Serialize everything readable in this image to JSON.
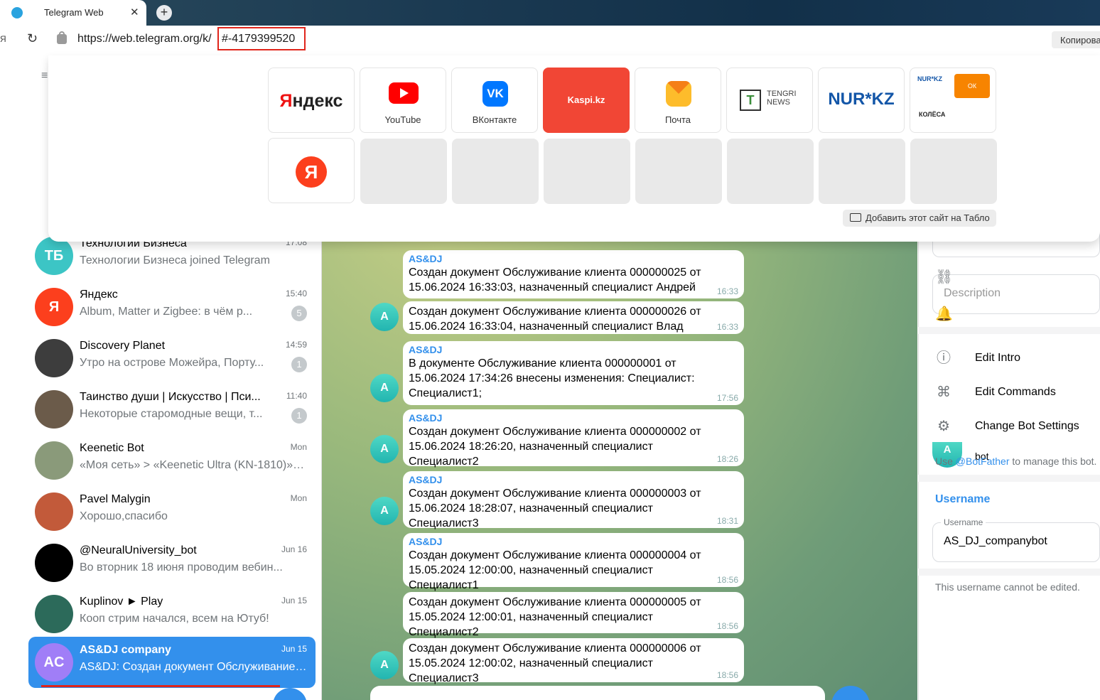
{
  "browser": {
    "tab_title": "Telegram Web",
    "tab_close": "✕",
    "new_tab": "+",
    "url_base": "https://web.telegram.org/k/",
    "url_hash": "#-4179399520",
    "copy_label": "Копирова"
  },
  "tablo": {
    "tiles": [
      {
        "label": "Яндекс"
      },
      {
        "label": "YouTube"
      },
      {
        "label": "ВКонтакте"
      },
      {
        "label": "Kaspi.kz"
      },
      {
        "label": "Почта"
      },
      {
        "label": "TENGRI NEWS"
      },
      {
        "label": "NUR KZ"
      },
      {
        "label": "NUR KZ / OK / Колёса"
      }
    ],
    "tengri_line1": "TENGRI",
    "tengri_line2": "NEWS",
    "nur_logo": "NUR*KZ",
    "mini_nur": "NUR*KZ",
    "mini_ok": "ОК",
    "mini_kolesa": "КОЛЁСА",
    "yandex_round": "Я",
    "add_label": "Добавить этот сайт на Табло"
  },
  "sidebar": {
    "menu_icon": "≡",
    "chats": [
      {
        "initials": "ТБ",
        "name": "Технологии Бизнеса",
        "message": "Технологии Бизнеса joined Telegram",
        "time": "17:08",
        "color": "#3cc5c5"
      },
      {
        "initials": "Я",
        "name": "Яндекс",
        "message": "Album, Matter и Zigbee: в чём р...",
        "time": "15:40",
        "badge": "5",
        "color": "#fc3f1d"
      },
      {
        "initials": "",
        "name": "Discovery Planet",
        "message": "Утро на острове Можейра, Порту...",
        "time": "14:59",
        "badge": "1",
        "color": "#3d3d3d"
      },
      {
        "initials": "",
        "name": "Таинство души | Искусство | Пси...",
        "message": "Некоторые старомодные вещи, т...",
        "time": "11:40",
        "badge": "1",
        "color": "#6b5b4a"
      },
      {
        "initials": "",
        "name": "Keenetic Bot",
        "message": "«Моя сеть» > «Keenetic Ultra (KN-1810)» Н...",
        "time": "Mon",
        "color": "#8a9a7a"
      },
      {
        "initials": "",
        "name": "Pavel Malygin",
        "message": "Хорошо,спасибо",
        "time": "Mon",
        "color": "#c25a3a"
      },
      {
        "initials": "",
        "name": "@NeuralUniversity_bot",
        "message": "Во вторник 18 июня проводим вебин...",
        "time": "Jun 16",
        "color": "#000000"
      },
      {
        "initials": "",
        "name": "Kuplinov ► Play",
        "message": "Кооп стрим начался, всем на Ютуб!",
        "time": "Jun 15",
        "color": "#2c6a5a"
      },
      {
        "initials": "AC",
        "name": "AS&DJ company",
        "message": "AS&DJ: Создан документ Обслуживание ...",
        "time": "Jun 15",
        "color": "#a07ef7",
        "active": true
      }
    ]
  },
  "messages": [
    {
      "sender": "AS&DJ",
      "text": "Создан документ Обслуживание клиента 000000025 от 15.06.2024 16:33:03, назначенный специалист Андрей",
      "time": "16:33"
    },
    {
      "sender": "",
      "text": "Создан документ Обслуживание клиента 000000026 от 15.06.2024 16:33:04, назначенный специалист Влад",
      "time": "16:33",
      "avatar": "A"
    },
    {
      "sender": "AS&DJ",
      "text": "В документе Обслуживание клиента 000000001 от 15.06.2024 17:34:26 внесены изменения: Специалист: Специалист1;",
      "time": "17:56",
      "avatar": "A"
    },
    {
      "sender": "AS&DJ",
      "text": "Создан документ Обслуживание клиента 000000002 от 15.06.2024 18:26:20, назначенный специалист Специалист2",
      "time": "18:26",
      "avatar": "A"
    },
    {
      "sender": "AS&DJ",
      "text": "Создан документ Обслуживание клиента 000000003 от 15.06.2024 18:28:07, назначенный специалист Специалист3",
      "time": "18:31",
      "avatar": "A"
    },
    {
      "sender": "AS&DJ",
      "text": "Создан документ Обслуживание клиента 000000004 от 15.05.2024 12:00:00, назначенный специалист Специалист1",
      "time": "18:56"
    },
    {
      "sender": "",
      "text": "Создан документ Обслуживание клиента 000000005 от 15.05.2024 12:00:01, назначенный специалист Специалист2",
      "time": "18:56"
    },
    {
      "sender": "",
      "text": "Создан документ Обслуживание клиента 000000006 от 15.05.2024 12:00:02, назначенный специалист Специалист3",
      "time": "18:56",
      "avatar": "A"
    }
  ],
  "right_panel": {
    "description_placeholder": "Description",
    "edit_intro": "Edit Intro",
    "edit_commands": "Edit Commands",
    "change_settings": "Change Bot Settings",
    "botfather_prefix": "Use ",
    "botfather_link": "@BotFather",
    "botfather_suffix": " to manage this bot.",
    "username_header": "Username",
    "username_label": "Username",
    "username_value": "AS_DJ_companybot",
    "username_note": "This username cannot be edited.",
    "peek_avatar": "A",
    "peek_text": "bot"
  }
}
